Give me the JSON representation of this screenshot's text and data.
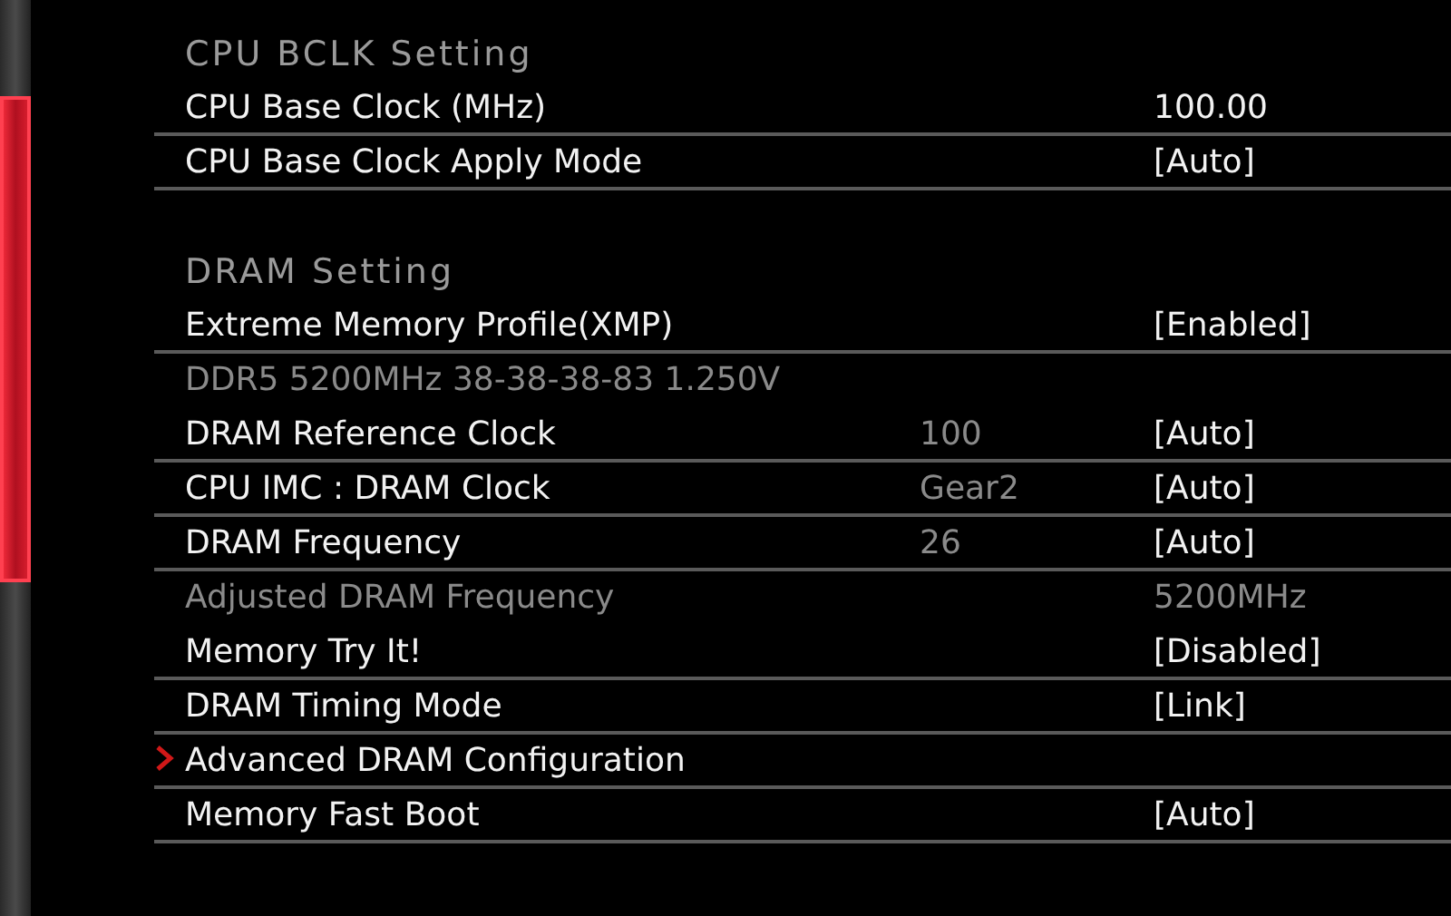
{
  "sections": [
    {
      "title": "CPU BCLK Setting",
      "items": [
        {
          "kind": "setting",
          "label": "CPU Base Clock (MHz)",
          "value": "100.00"
        },
        {
          "kind": "setting",
          "label": "CPU Base Clock Apply Mode",
          "value": "[Auto]"
        }
      ]
    },
    {
      "title": "DRAM Setting",
      "items": [
        {
          "kind": "setting",
          "label": "Extreme Memory Profile(XMP)",
          "value": "[Enabled]"
        },
        {
          "kind": "info",
          "label": "DDR5 5200MHz 38-38-38-83 1.250V"
        },
        {
          "kind": "setting",
          "label": "DRAM Reference Clock",
          "current": "100",
          "value": "[Auto]"
        },
        {
          "kind": "setting",
          "label": "CPU IMC : DRAM Clock",
          "current": "Gear2",
          "value": "[Auto]"
        },
        {
          "kind": "setting",
          "label": "DRAM Frequency",
          "current": "26",
          "value": "[Auto]"
        },
        {
          "kind": "info",
          "label": "Adjusted DRAM Frequency",
          "value": "5200MHz"
        },
        {
          "kind": "setting",
          "label": "Memory Try It!",
          "value": "[Disabled]"
        },
        {
          "kind": "setting",
          "label": "DRAM Timing Mode",
          "value": "[Link]"
        },
        {
          "kind": "submenu",
          "label": "Advanced DRAM Configuration"
        },
        {
          "kind": "setting",
          "label": "Memory Fast Boot",
          "value": "[Auto]"
        }
      ]
    }
  ]
}
